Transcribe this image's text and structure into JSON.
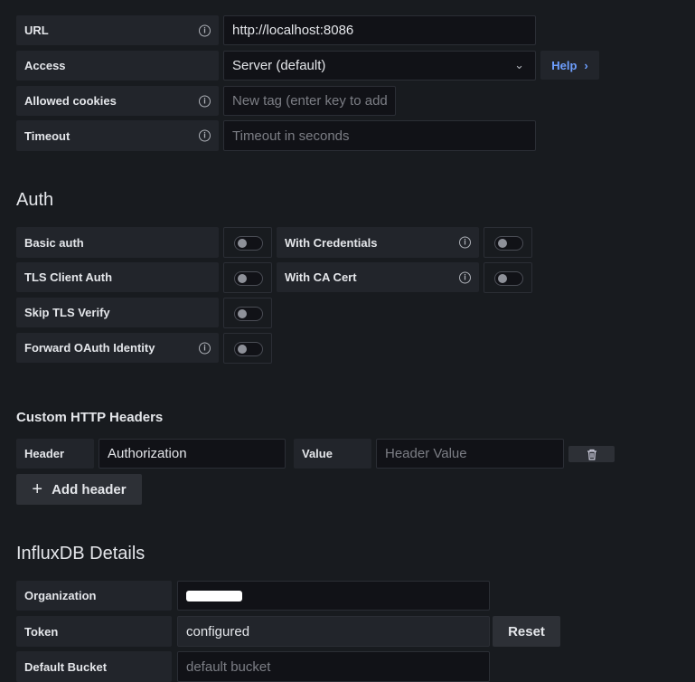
{
  "http": {
    "url": {
      "label": "URL",
      "value": "http://localhost:8086"
    },
    "access": {
      "label": "Access",
      "value": "Server (default)",
      "help": "Help"
    },
    "cookies": {
      "label": "Allowed cookies",
      "placeholder": "New tag (enter key to add"
    },
    "timeout": {
      "label": "Timeout",
      "placeholder": "Timeout in seconds"
    }
  },
  "auth": {
    "title": "Auth",
    "basic": "Basic auth",
    "credentials": "With Credentials",
    "tls": "TLS Client Auth",
    "ca": "With CA Cert",
    "skip": "Skip TLS Verify",
    "oauth": "Forward OAuth Identity"
  },
  "headers": {
    "title": "Custom HTTP Headers",
    "header_label": "Header",
    "header_value": "Authorization",
    "value_label": "Value",
    "value_placeholder": "Header Value",
    "add": "Add header"
  },
  "influx": {
    "title": "InfluxDB Details",
    "org_label": "Organization",
    "token_label": "Token",
    "token_value": "configured",
    "reset": "Reset",
    "bucket_label": "Default Bucket",
    "bucket_placeholder": "default bucket"
  }
}
